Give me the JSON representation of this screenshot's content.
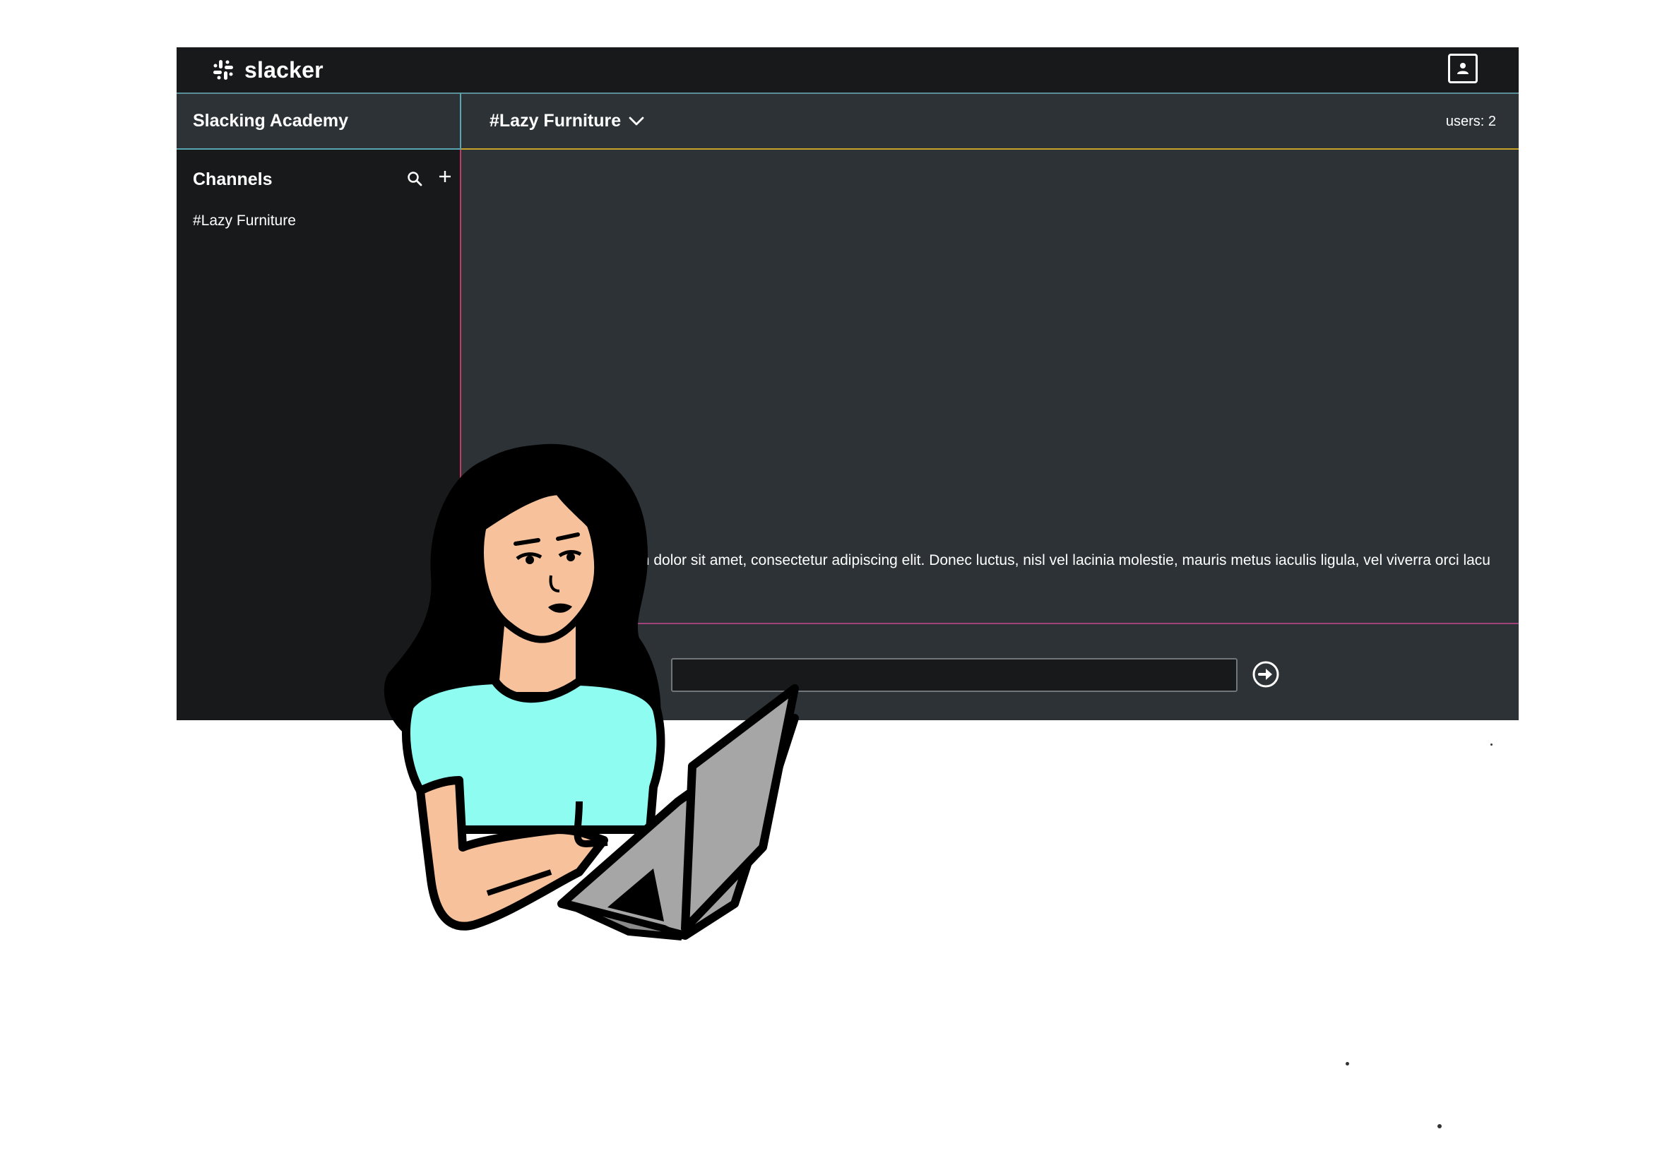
{
  "app": {
    "name": "slacker",
    "workspace": "Slacking Academy"
  },
  "sidebar": {
    "section_label": "Channels",
    "channels": [
      {
        "label": "#Lazy Furniture"
      }
    ]
  },
  "channel_header": {
    "title": "#Lazy Furniture",
    "users": "users: 2"
  },
  "messages": [
    {
      "text": "Lorem ipsum dolor sit amet, consectetur adipiscing elit. Donec luctus, nisl vel lacinia molestie, mauris metus iaculis ligula, vel viverra orci lacu"
    }
  ],
  "composer": {
    "value": "",
    "placeholder": ""
  },
  "icons": {
    "logo": "slack-hash-icon",
    "profile": "user-profile-icon",
    "search": "search-icon",
    "add": "plus-icon",
    "dropdown": "chevron-down-icon",
    "send": "arrow-right-circle-icon"
  },
  "colors": {
    "topbar": "#18191a",
    "panel": "#2c3235",
    "sidebar": "#18191a",
    "accent_teal": "#5aa6b1",
    "accent_gold": "#c8a228",
    "accent_pink": "#c23a63",
    "accent_purple": "#a0427a",
    "shirt": "#8ffcf2",
    "skin": "#f6c19b",
    "laptop": "#a6a6a6"
  }
}
